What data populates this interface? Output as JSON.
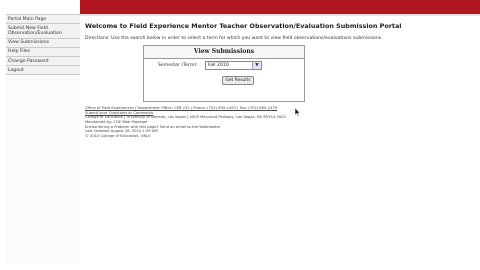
{
  "header": {
    "brand_color": "#b0141c"
  },
  "sidebar": {
    "items": [
      {
        "label": "Portal Main Page"
      },
      {
        "label": "Submit New Field Observation/Evaluation"
      },
      {
        "label": "View Submissions"
      },
      {
        "label": "Help Files"
      },
      {
        "label": "Change Password"
      },
      {
        "label": "Logout"
      }
    ]
  },
  "main": {
    "title": "Welcome to Field Experience Mentor Teacher Observation/Evaluation Submission Portal",
    "directions": "Directions: Use the search below in order to select a term for which you want to view field observations/evaluations submissions.",
    "panel": {
      "title": "View Submissions",
      "semester_label": "Semester (Term):",
      "semester_value": "Fall 2010",
      "submit_label": "Get Results"
    }
  },
  "footer": {
    "lines": [
      "Office of Field Experiences | Department Office: CEB 232 | Phone: (702) 895-1493 | Fax: (702) 895-2479",
      "Submit your Questions or Comments",
      "College of Education | University of Nevada, Las Vegas | 4505 Maryland Parkway, Las Vegas, NV 89154-3002",
      "Maintained by: COE Web Manager",
      "Encountering a Problem with this page? Send an email to the Webmaster",
      "Last Updated August 26, 2010 1:56 AM",
      "© 2010 College of Education, UNLV"
    ]
  }
}
